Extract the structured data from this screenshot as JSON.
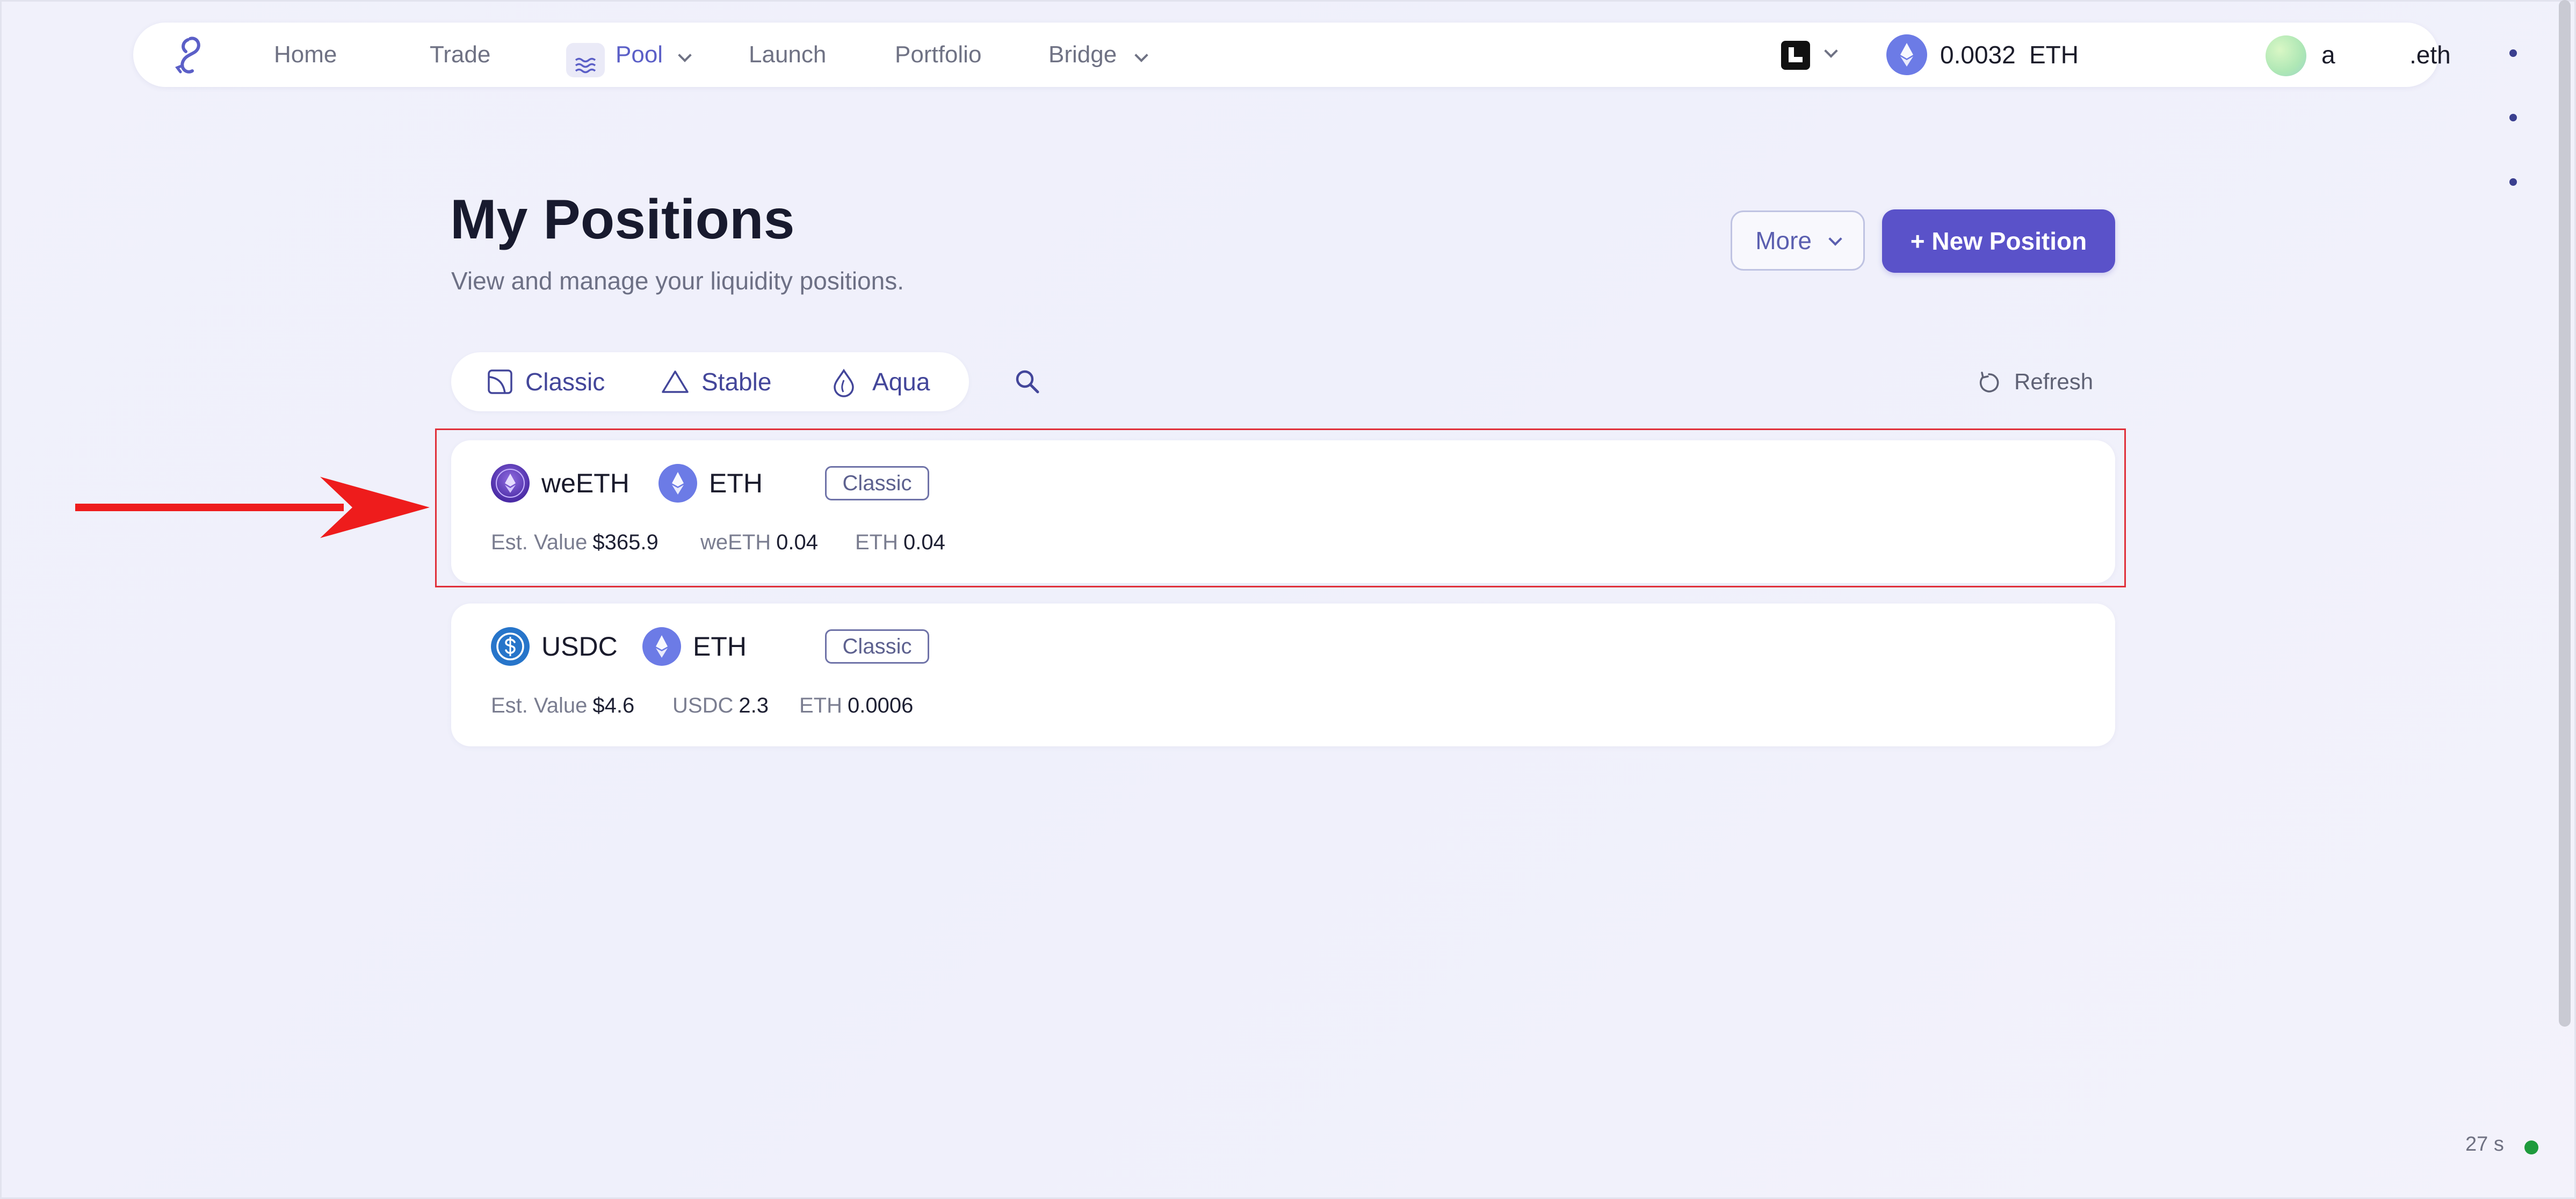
{
  "nav": {
    "items": [
      {
        "label": "Home"
      },
      {
        "label": "Trade"
      },
      {
        "label": "Pool"
      },
      {
        "label": "Launch"
      },
      {
        "label": "Portfolio"
      },
      {
        "label": "Bridge"
      }
    ],
    "balance_amount": "0.0032",
    "balance_unit": "ETH",
    "account_name": "a",
    "account_suffix": ".eth"
  },
  "header": {
    "title": "My Positions",
    "subtitle": "View and manage your liquidity positions.",
    "more_label": "More",
    "new_position_label": "+ New Position"
  },
  "filters": {
    "tabs": [
      {
        "label": "Classic"
      },
      {
        "label": "Stable"
      },
      {
        "label": "Aqua"
      }
    ],
    "refresh_label": "Refresh"
  },
  "positions": [
    {
      "token_a": "weETH",
      "token_b": "ETH",
      "type": "Classic",
      "est_value_label": "Est. Value",
      "est_value": "$365.9",
      "amount_a_label": "weETH",
      "amount_a": "0.04",
      "amount_b_label": "ETH",
      "amount_b": "0.04"
    },
    {
      "token_a": "USDC",
      "token_b": "ETH",
      "type": "Classic",
      "est_value_label": "Est. Value",
      "est_value": "$4.6",
      "amount_a_label": "USDC",
      "amount_a": "2.3",
      "amount_b_label": "ETH",
      "amount_b": "0.0006"
    }
  ],
  "status": {
    "timer": "27 s"
  },
  "colors": {
    "accent": "#5a52c9",
    "highlight": "#e0303a",
    "arrow": "#ee1c1c",
    "status_online": "#1e9a3c"
  }
}
